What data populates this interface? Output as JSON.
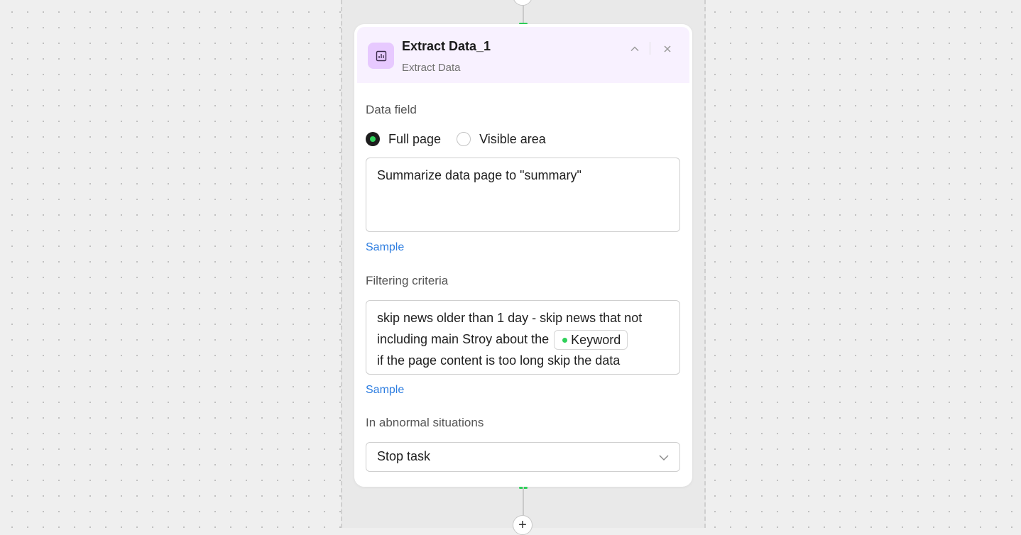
{
  "node": {
    "title": "Extract Data_1",
    "subtitle": "Extract Data",
    "icon": "bar-chart-icon",
    "accent_color": "#e7c9ff",
    "header_background": "#f8f1ff"
  },
  "data_field": {
    "label": "Data field",
    "options": [
      {
        "label": "Full page",
        "selected": true
      },
      {
        "label": "Visible area",
        "selected": false
      }
    ],
    "value": "Summarize data page to \"summary\"",
    "sample_label": "Sample"
  },
  "filtering": {
    "label": "Filtering criteria",
    "line1": "skip news older than 1 day - skip news that not",
    "line2_prefix": "including main Stroy about the",
    "variable_chip": "Keyword",
    "line3": "if the page content is too long skip the data",
    "sample_label": "Sample"
  },
  "abnormal": {
    "label": "In abnormal situations",
    "selected": "Stop task"
  },
  "colors": {
    "connector_green": "#2fd05a",
    "link_blue": "#2d7de0"
  }
}
